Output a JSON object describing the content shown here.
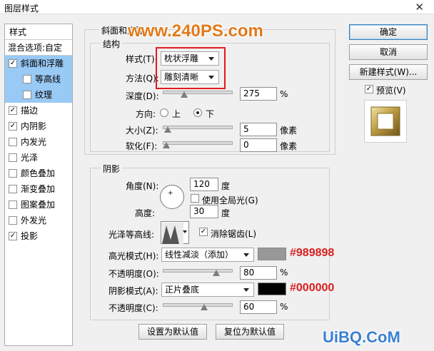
{
  "window": {
    "title": "图层样式",
    "close": "✕"
  },
  "styles_panel": {
    "header": "样式",
    "blend_options": "混合选项:自定",
    "items": [
      {
        "label": "斜面和浮雕",
        "checked": true,
        "selected": true,
        "sub": false
      },
      {
        "label": "等高线",
        "checked": false,
        "selected": true,
        "sub": true
      },
      {
        "label": "纹理",
        "checked": false,
        "selected": true,
        "sub": true
      },
      {
        "label": "描边",
        "checked": true,
        "sub": false
      },
      {
        "label": "内阴影",
        "checked": true,
        "sub": false
      },
      {
        "label": "内发光",
        "checked": false,
        "sub": false
      },
      {
        "label": "光泽",
        "checked": false,
        "sub": false
      },
      {
        "label": "颜色叠加",
        "checked": false,
        "sub": false
      },
      {
        "label": "渐变叠加",
        "checked": false,
        "sub": false
      },
      {
        "label": "图案叠加",
        "checked": false,
        "sub": false
      },
      {
        "label": "外发光",
        "checked": false,
        "sub": false
      },
      {
        "label": "投影",
        "checked": true,
        "sub": false
      }
    ]
  },
  "bevel": {
    "group_title": "斜面和浮雕",
    "structure_title": "结构",
    "style_label": "样式(T):",
    "style_value": "枕状浮雕",
    "technique_label": "方法(Q):",
    "technique_value": "雕刻清晰",
    "depth_label": "深度(D):",
    "depth_value": "275",
    "depth_unit": "%",
    "depth_level": 0.28,
    "direction_label": "方向:",
    "direction_up": "上",
    "direction_down": "下",
    "size_label": "大小(Z):",
    "size_value": "5",
    "size_unit": "像素",
    "size_level": 0.02,
    "soften_label": "软化(F):",
    "soften_value": "0",
    "soften_unit": "像素",
    "soften_level": 0.0
  },
  "shading": {
    "title": "阴影",
    "angle_label": "角度(N):",
    "angle_value": "120",
    "angle_unit": "度",
    "global_light_label": "使用全局光(G)",
    "altitude_label": "高度:",
    "altitude_value": "30",
    "altitude_unit": "度",
    "gloss_label": "光泽等高线:",
    "antialias_label": "消除锯齿(L)",
    "highlight_mode_label": "高光模式(H):",
    "highlight_mode_value": "线性减淡（添加）",
    "highlight_color": "#989898",
    "highlight_hex_annotation": "#989898",
    "highlight_opacity_label": "不透明度(O):",
    "highlight_opacity_value": "80",
    "highlight_opacity_unit": "%",
    "highlight_opacity_level": 0.8,
    "shadow_mode_label": "阴影模式(A):",
    "shadow_mode_value": "正片叠底",
    "shadow_color": "#000000",
    "shadow_hex_annotation": "#000000",
    "shadow_opacity_label": "不透明度(C):",
    "shadow_opacity_value": "60",
    "shadow_opacity_unit": "%",
    "shadow_opacity_level": 0.6
  },
  "footer": {
    "set_default": "设置为默认值",
    "reset_default": "复位为默认值"
  },
  "actions": {
    "ok": "确定",
    "cancel": "取消",
    "new_style": "新建样式(W)...",
    "preview_label": "预览(V)"
  },
  "watermarks": {
    "top": "www.240PS.com",
    "bottom": "UiBQ.CoM"
  }
}
